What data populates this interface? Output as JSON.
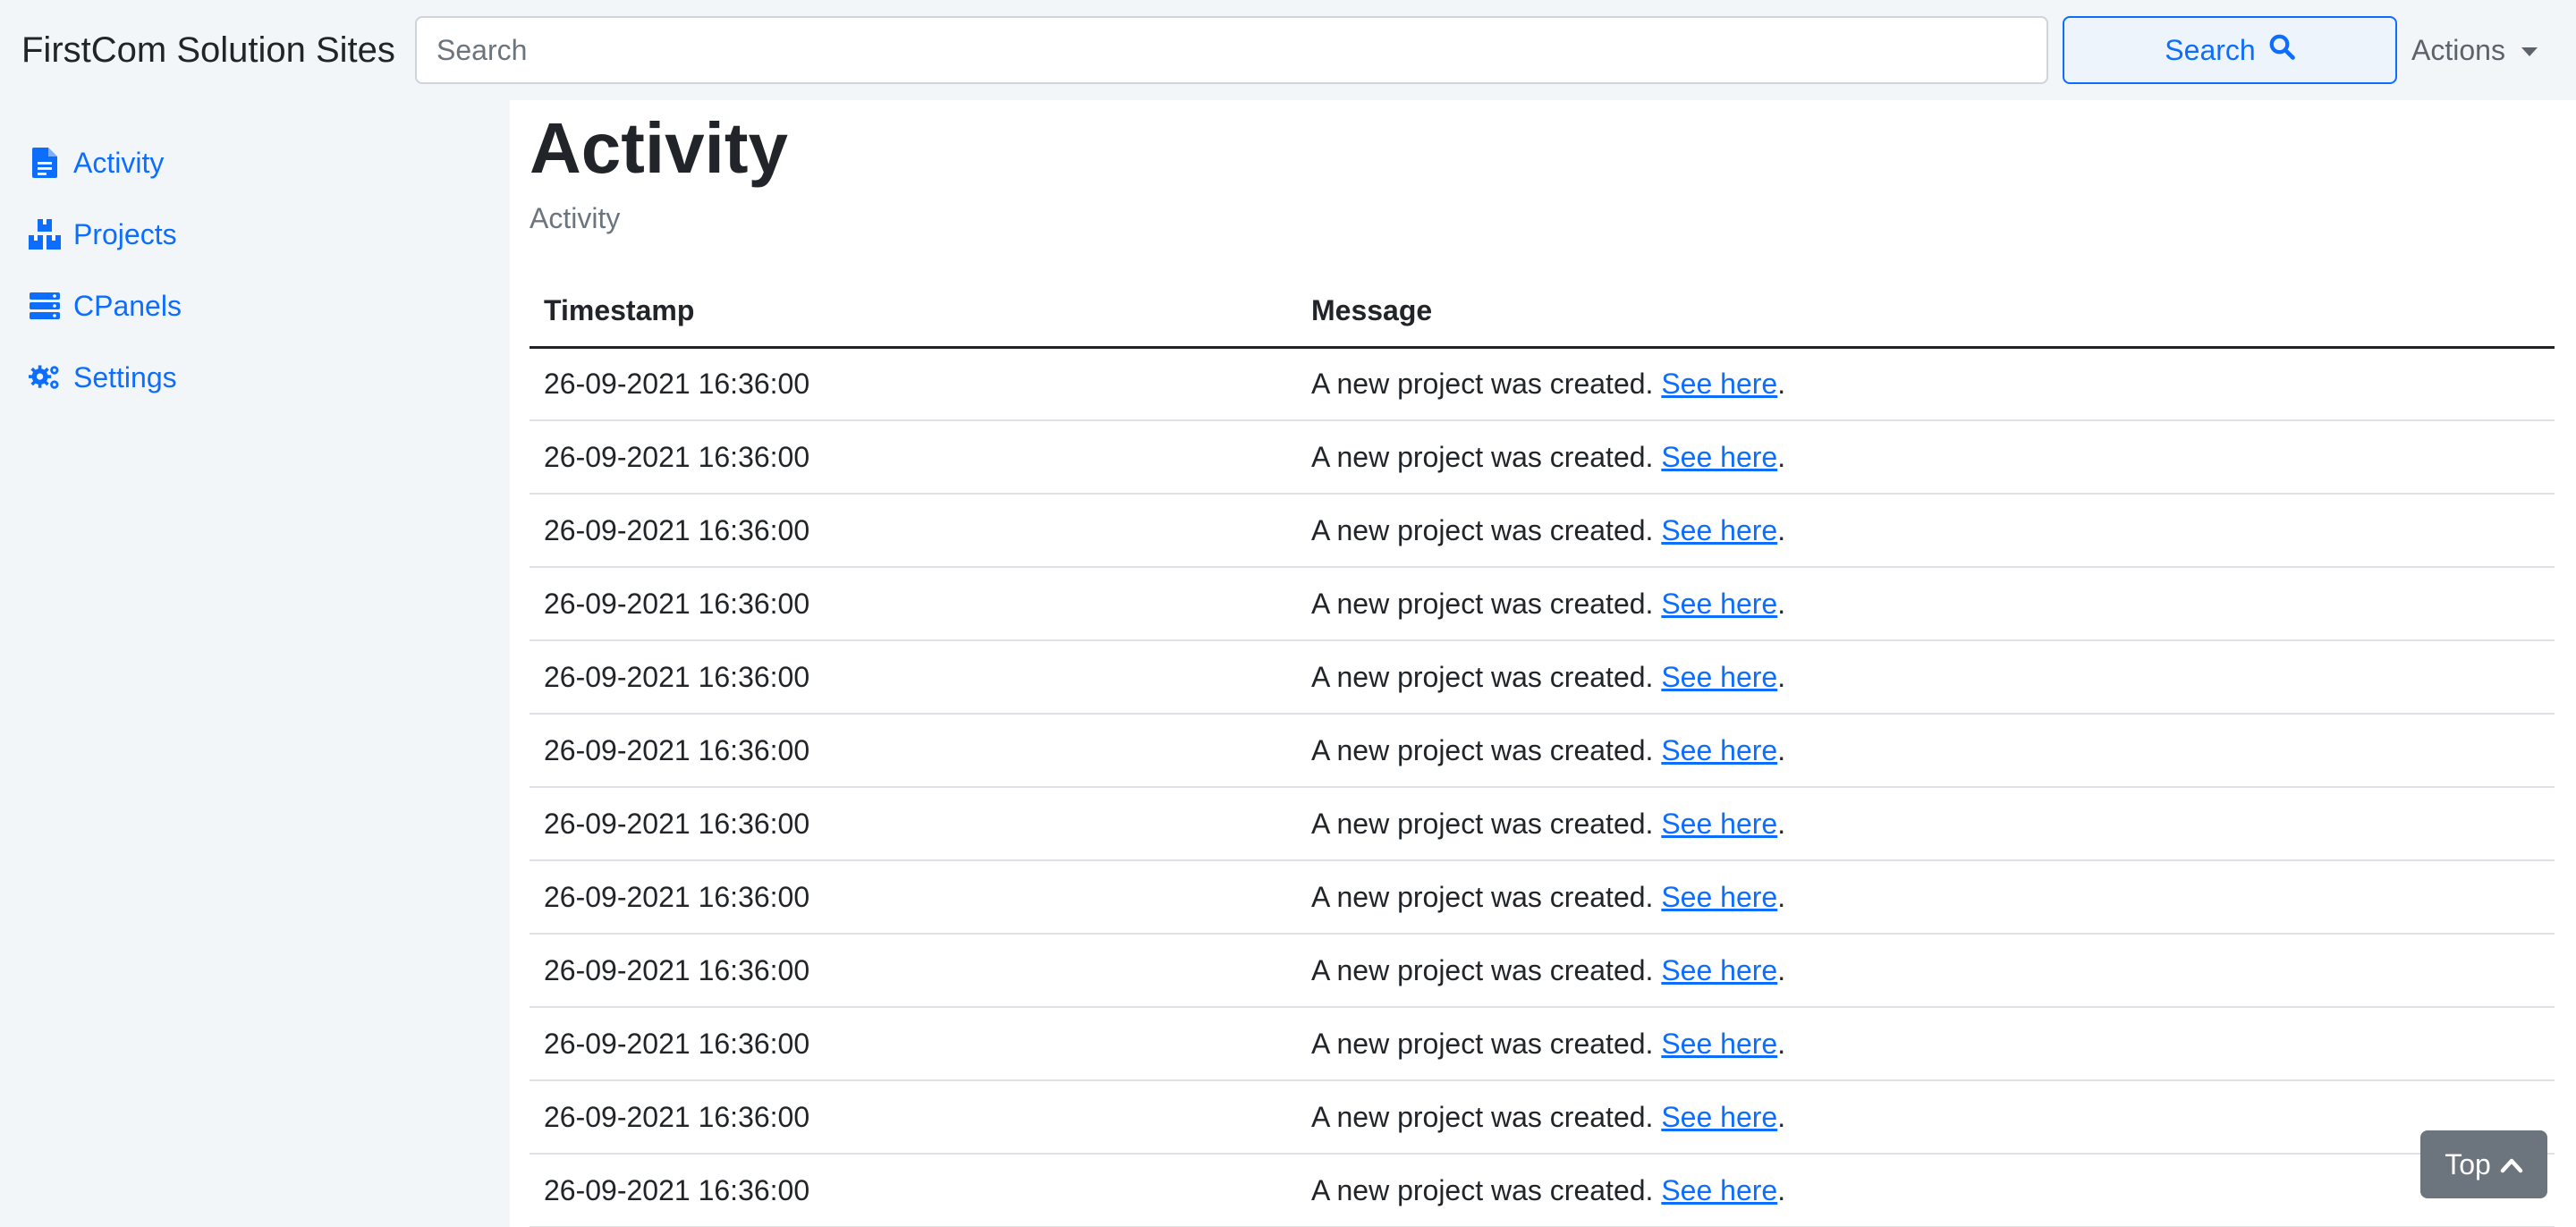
{
  "navbar": {
    "brand": "FirstCom Solution Sites",
    "search_placeholder": "Search",
    "search_value": "",
    "search_button_label": "Search",
    "actions_label": "Actions"
  },
  "sidebar": {
    "items": [
      {
        "label": "Activity",
        "icon": "file-icon"
      },
      {
        "label": "Projects",
        "icon": "boxes-icon"
      },
      {
        "label": "CPanels",
        "icon": "server-icon"
      },
      {
        "label": "Settings",
        "icon": "gears-icon"
      }
    ]
  },
  "main": {
    "title": "Activity",
    "subtitle": "Activity",
    "table": {
      "headers": [
        "Timestamp",
        "Message"
      ],
      "rows": [
        {
          "timestamp": "26-09-2021 16:36:00",
          "message": "A new project was created.",
          "link": "See here",
          "suffix": "."
        },
        {
          "timestamp": "26-09-2021 16:36:00",
          "message": "A new project was created.",
          "link": "See here",
          "suffix": "."
        },
        {
          "timestamp": "26-09-2021 16:36:00",
          "message": "A new project was created.",
          "link": "See here",
          "suffix": "."
        },
        {
          "timestamp": "26-09-2021 16:36:00",
          "message": "A new project was created.",
          "link": "See here",
          "suffix": "."
        },
        {
          "timestamp": "26-09-2021 16:36:00",
          "message": "A new project was created.",
          "link": "See here",
          "suffix": "."
        },
        {
          "timestamp": "26-09-2021 16:36:00",
          "message": "A new project was created.",
          "link": "See here",
          "suffix": "."
        },
        {
          "timestamp": "26-09-2021 16:36:00",
          "message": "A new project was created.",
          "link": "See here",
          "suffix": "."
        },
        {
          "timestamp": "26-09-2021 16:36:00",
          "message": "A new project was created.",
          "link": "See here",
          "suffix": "."
        },
        {
          "timestamp": "26-09-2021 16:36:00",
          "message": "A new project was created.",
          "link": "See here",
          "suffix": "."
        },
        {
          "timestamp": "26-09-2021 16:36:00",
          "message": "A new project was created.",
          "link": "See here",
          "suffix": "."
        },
        {
          "timestamp": "26-09-2021 16:36:00",
          "message": "A new project was created.",
          "link": "See here",
          "suffix": "."
        },
        {
          "timestamp": "26-09-2021 16:36:00",
          "message": "A new project was created.",
          "link": "See here",
          "suffix": "."
        }
      ]
    }
  },
  "top_button_label": "Top",
  "colors": {
    "accent": "#0d6efd",
    "page_background": "#f3f6f9",
    "top_button": "#6c757d"
  }
}
